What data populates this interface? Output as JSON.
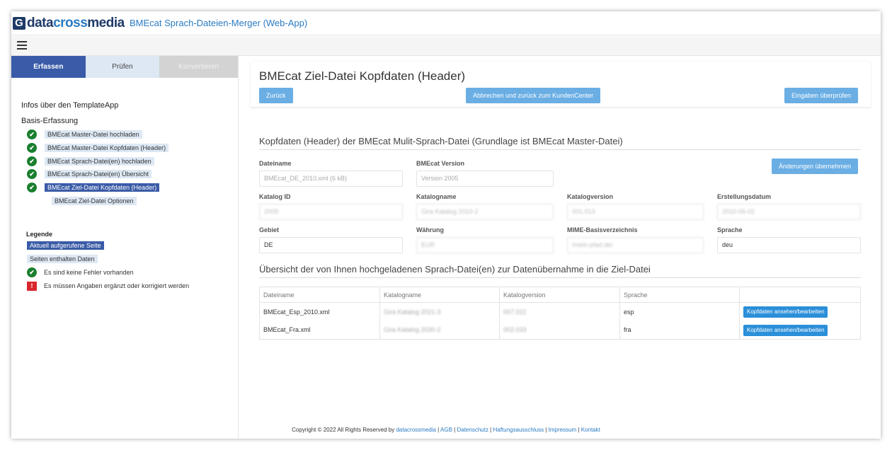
{
  "header": {
    "logo_mark": "G",
    "logo_text_1": "data",
    "logo_text_2": "cross",
    "logo_text_3": "media",
    "app_title": "BMEcat Sprach-Dateien-Merger (Web-App)"
  },
  "tabs": [
    {
      "label": "Erfassen"
    },
    {
      "label": "Prüfen"
    },
    {
      "label": "Konvertieren"
    }
  ],
  "sidebar": {
    "info_link": "Infos über den TemplateApp",
    "section": "Basis-Erfassung",
    "steps": [
      {
        "label": "BMEcat Master-Datei hochladen"
      },
      {
        "label": "BMEcat Master-Datei Kopfdaten (Header)"
      },
      {
        "label": "BMEcat Sprach-Datei(en) hochladen"
      },
      {
        "label": "BMEcat Sprach-Datei(en) Übersicht"
      },
      {
        "label": "BMEcat Ziel-Datei Kopfdaten (Header)"
      },
      {
        "label": "BMEcat Ziel-Datei Optionen"
      }
    ],
    "check_glyph": "✔",
    "legend": {
      "title": "Legende",
      "current": "Aktuell aufgerufene Seite",
      "has_data": "Seiten enthalten Daten",
      "no_errors": "Es sind keine Fehler vorhanden",
      "warning": "Es müssen Angaben ergänzt oder korrigiert werden",
      "warning_glyph": "!"
    }
  },
  "main": {
    "page_title": "BMEcat Ziel-Datei Kopfdaten (Header)",
    "buttons": {
      "back": "Zurück",
      "cancel": "Abbrechen und zurück zum KundenCenter",
      "check": "Eingaben überprüfen",
      "apply": "Änderungen übernehmen"
    },
    "section1_title": "Kopfdaten (Header) der BMEcat Mulit-Sprach-Datei (Grundlage ist BMEcat Master-Datei)",
    "fields": {
      "dateiname_label": "Dateiname",
      "dateiname_value": "BMEcat_DE_2010.xml (6 kB)",
      "version_label": "BMEcat Version",
      "version_value": "Version 2005",
      "katalog_id_label": "Katalog ID",
      "katalog_id_value": "2009",
      "katalogname_label": "Katalogname",
      "katalogname_value": "Gira Katalog 2010-2",
      "katalogversion_label": "Katalogversion",
      "katalogversion_value": "001.013",
      "erstellungsdatum_label": "Erstellungsdatum",
      "erstellungsdatum_value": "2010-06-02",
      "gebiet_label": "Gebiet",
      "gebiet_value": "DE",
      "waehrung_label": "Währung",
      "waehrung_value": "EUR",
      "mime_label": "MIME-Basisverzeichnis",
      "mime_value": "/mein-pfad.de/",
      "sprache_label": "Sprache",
      "sprache_value": "deu"
    },
    "section2_title": "Übersicht der von Ihnen hochgeladenen Sprach-Datei(en) zur Datenübernahme in die Ziel-Datei",
    "table": {
      "headers": [
        "Dateiname",
        "Katalogname",
        "Katalogversion",
        "Sprache",
        ""
      ],
      "rows": [
        {
          "dateiname": "BMEcat_Esp_2010.xml",
          "katalogname": "Gira Katalog 2021-3",
          "katalogversion": "007.022",
          "sprache": "esp",
          "action": "Kopfdaten ansehen/bearbeiten"
        },
        {
          "dateiname": "BMEcat_Fra.xml",
          "katalogname": "Gira Katalog 2030-2",
          "katalogversion": "002.033",
          "sprache": "fra",
          "action": "Kopfdaten ansehen/bearbeiten"
        }
      ]
    }
  },
  "footer": {
    "copyright": "Copyright © 2022 All Rights Reserved by ",
    "links": [
      "datacrossmedia",
      "AGB",
      "Datenschutz",
      "Haftungsausschluss",
      "Impressum",
      "Kontakt"
    ],
    "separator": " | "
  }
}
